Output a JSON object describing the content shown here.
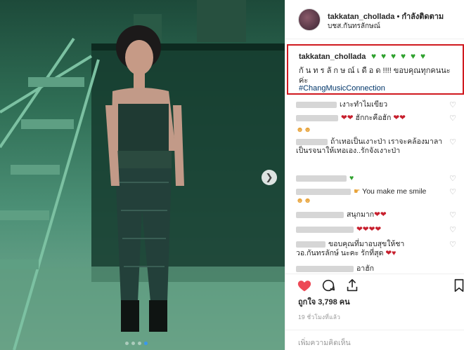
{
  "post": {
    "username": "takkatan_chollada",
    "follow_text": "• กำลังติดตาม",
    "location": "บชส.กันทรลักษณ์",
    "caption": {
      "username": "takkatan_chollada",
      "line1": "กั น ท ร ลั ก ษ ณ์ เ ดื อ ด !!!! ขอบคุณทุกคนนะ",
      "line2": "ค่ะ",
      "hashtag": "#ChangMusicConnection",
      "green_heart_count": 6
    },
    "comments": [
      {
        "text": "เงาะทำไมเขียว"
      },
      {
        "text": "ฮักกะคือฮัก"
      },
      {
        "text": ""
      },
      {
        "text": "ถ้าเทอเป็นเงาะป่า เราจะคล้องมาลา เป็นรจนาให้เทอเอง..รักจังเงาะป่า"
      },
      {
        "text": ""
      },
      {
        "text": "You make me smile"
      },
      {
        "text": "สนุกมาก"
      },
      {
        "text": ""
      },
      {
        "text": "ขอบคุณที่มาอบสุขให้ชาวอ.กันทรลักษ์ นะคะ รักที่สุด"
      },
      {
        "text": "อาฮัก"
      }
    ],
    "likes_label": "ถูกใจ 3,798 คน",
    "time_ago": "19 ชั่วโมงที่แล้ว",
    "add_comment_placeholder": "เพิ่มความคิดเห็น",
    "carousel": {
      "total_slides": 4,
      "active_slide": 4
    }
  },
  "icons": {
    "like": "heart-filled-icon",
    "comment": "comment-bubble-icon",
    "share": "share-icon",
    "save": "bookmark-icon",
    "next": "chevron-right-icon"
  },
  "colors": {
    "like_red": "#ed4956",
    "highlight_border": "#d0191f",
    "hashtag_blue": "#003569",
    "green_heart": "#2fa12e"
  }
}
